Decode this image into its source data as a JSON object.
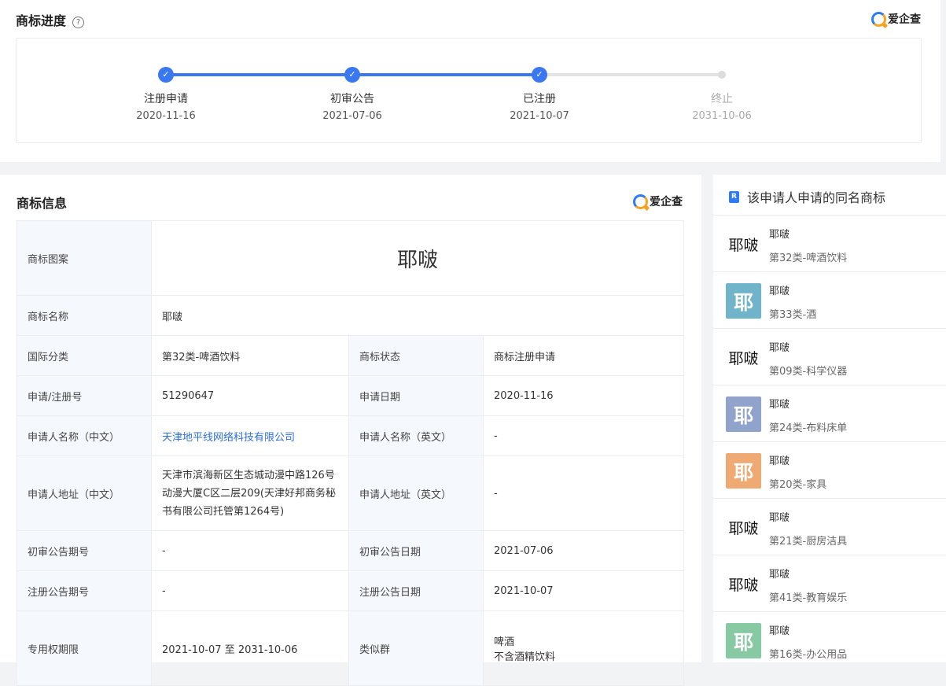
{
  "progress": {
    "title": "商标进度",
    "help_glyph": "?",
    "brand": "爱企查",
    "check_glyph": "✓",
    "steps": [
      {
        "label": "注册申请",
        "date": "2020-11-16",
        "done": true
      },
      {
        "label": "初审公告",
        "date": "2021-07-06",
        "done": true
      },
      {
        "label": "已注册",
        "date": "2021-10-07",
        "done": true
      },
      {
        "label": "终止",
        "date": "2031-10-06",
        "done": false
      }
    ]
  },
  "info": {
    "title": "商标信息",
    "brand": "爱企查",
    "trademark_image_text": "耶啵",
    "rows": {
      "image_label": "商标图案",
      "name_label": "商标名称",
      "name_value": "耶啵",
      "class_label": "国际分类",
      "class_value": "第32类-啤酒饮料",
      "status_label": "商标状态",
      "status_value": "商标注册申请",
      "regno_label": "申请/注册号",
      "regno_value": "51290647",
      "appdate_label": "申请日期",
      "appdate_value": "2020-11-16",
      "applicant_cn_label": "申请人名称（中文）",
      "applicant_cn_value": "天津地平线网络科技有限公司",
      "applicant_en_label": "申请人名称（英文）",
      "applicant_en_value": "-",
      "address_cn_label": "申请人地址（中文）",
      "address_cn_value": "天津市滨海新区生态城动漫中路126号动漫大厦C区二层209(天津好邦商务秘书有限公司托管第1264号)",
      "address_en_label": "申请人地址（英文）",
      "address_en_value": "-",
      "prelim_no_label": "初审公告期号",
      "prelim_no_value": "-",
      "prelim_date_label": "初审公告日期",
      "prelim_date_value": "2021-07-06",
      "reg_no_label": "注册公告期号",
      "reg_no_value": "-",
      "reg_date_label": "注册公告日期",
      "reg_date_value": "2021-10-07",
      "term_label": "专用权期限",
      "term_value": "2021-10-07 至 2031-10-06",
      "similar_label": "类似群",
      "similar_value_1": "啤酒",
      "similar_value_2": "不含酒精饮料"
    }
  },
  "side": {
    "title": "该申请人申请的同名商标",
    "icon_glyph": "R",
    "items": [
      {
        "thumb": "耶啵",
        "thumb_style": "text",
        "name": "耶啵",
        "class": "第32类-啤酒饮料"
      },
      {
        "thumb": "耶",
        "thumb_style": "block",
        "color": "#6fb4c9",
        "name": "耶啵",
        "class": "第33类-酒"
      },
      {
        "thumb": "耶啵",
        "thumb_style": "text",
        "name": "耶啵",
        "class": "第09类-科学仪器"
      },
      {
        "thumb": "耶",
        "thumb_style": "block",
        "color": "#8fa3cc",
        "name": "耶啵",
        "class": "第24类-布料床单"
      },
      {
        "thumb": "耶",
        "thumb_style": "block",
        "color": "#eeaa72",
        "name": "耶啵",
        "class": "第20类-家具"
      },
      {
        "thumb": "耶啵",
        "thumb_style": "text",
        "name": "耶啵",
        "class": "第21类-厨房洁具"
      },
      {
        "thumb": "耶啵",
        "thumb_style": "text",
        "name": "耶啵",
        "class": "第41类-教育娱乐"
      },
      {
        "thumb": "耶",
        "thumb_style": "block",
        "color": "#86c9a2",
        "name": "耶啵",
        "class": "第16类-办公用品"
      }
    ]
  }
}
